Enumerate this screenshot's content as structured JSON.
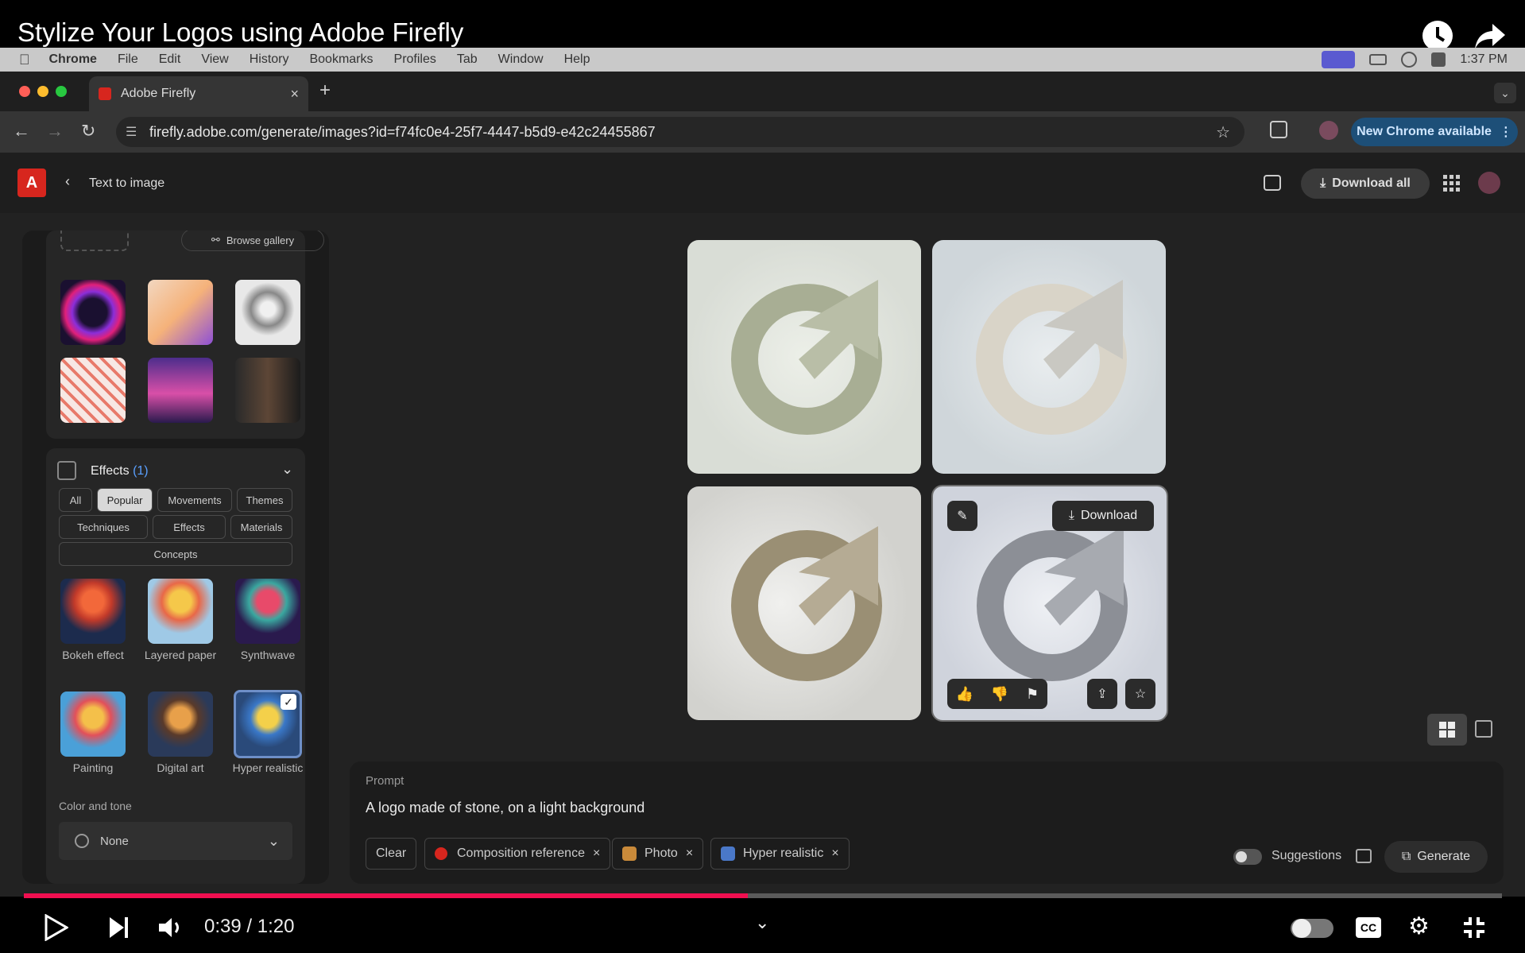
{
  "video": {
    "title": "Stylize Your Logos using Adobe Firefly",
    "time": "0:39 / 1:20",
    "progress": 0.49
  },
  "menubar": {
    "items": [
      "Chrome",
      "File",
      "Edit",
      "View",
      "History",
      "Bookmarks",
      "Profiles",
      "Tab",
      "Window",
      "Help"
    ],
    "clock": "1:37 PM"
  },
  "browser": {
    "tab_title": "Adobe Firefly",
    "url": "firefly.adobe.com/generate/images?id=f74fc0e4-25f7-4447-b5d9-e42c24455867",
    "new_chrome": "New Chrome available"
  },
  "firefly": {
    "back_label": "Text to image",
    "download_all": "Download all",
    "browse_gallery": "Browse gallery",
    "effects_label": "Effects",
    "effects_count": "(1)",
    "filter_chips": [
      "All",
      "Popular",
      "Movements",
      "Themes",
      "Techniques",
      "Effects",
      "Materials",
      "Concepts"
    ],
    "selected_chip": "Popular",
    "effects": [
      {
        "label": "Bokeh effect",
        "selected": false
      },
      {
        "label": "Layered paper",
        "selected": false
      },
      {
        "label": "Synthwave",
        "selected": false
      },
      {
        "label": "Painting",
        "selected": false
      },
      {
        "label": "Digital art",
        "selected": false
      },
      {
        "label": "Hyper realistic",
        "selected": true
      }
    ],
    "color_tone_label": "Color and tone",
    "color_tone_value": "None",
    "download_label": "Download",
    "prompt_label": "Prompt",
    "prompt_text": "A logo made of stone, on a light background",
    "clear_label": "Clear",
    "tags": [
      "Composition reference",
      "Photo",
      "Hyper realistic"
    ],
    "suggestions_label": "Suggestions",
    "generate_label": "Generate"
  },
  "colors": {
    "accent": "#d7261e",
    "progress": "#f00f50",
    "chrome_badge": "#1d4f78"
  }
}
